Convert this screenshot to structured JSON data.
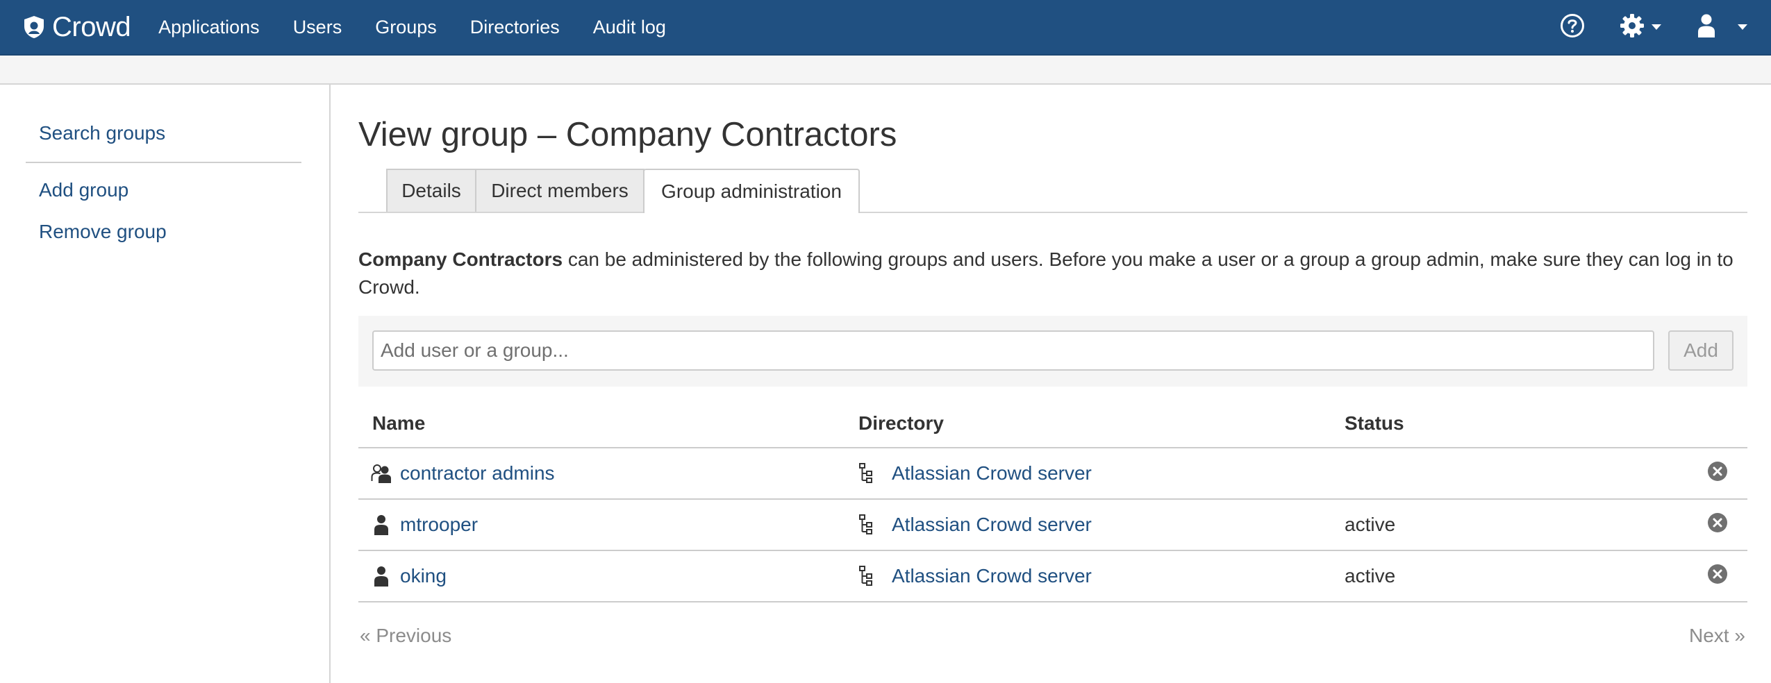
{
  "header": {
    "logo_text": "Crowd",
    "nav": [
      "Applications",
      "Users",
      "Groups",
      "Directories",
      "Audit log"
    ],
    "icons": [
      "help-icon",
      "gear-icon",
      "user-icon"
    ]
  },
  "sidebar": {
    "items": [
      {
        "label": "Search groups"
      },
      {
        "label": "Add group"
      },
      {
        "label": "Remove group"
      }
    ]
  },
  "page": {
    "title": "View group – Company Contractors",
    "tabs": [
      {
        "label": "Details",
        "active": false
      },
      {
        "label": "Direct members",
        "active": false
      },
      {
        "label": "Group administration",
        "active": true
      }
    ],
    "description_bold": "Company Contractors",
    "description_rest": " can be administered by the following groups and users. Before you make a user or a group a group admin, make sure they can log in to Crowd.",
    "add_placeholder": "Add user or a group...",
    "add_button": "Add"
  },
  "table": {
    "headers": [
      "Name",
      "Directory",
      "Status"
    ],
    "rows": [
      {
        "type": "group",
        "icon": "group-icon",
        "name": "contractor admins",
        "directory": "Atlassian Crowd server",
        "status": ""
      },
      {
        "type": "user",
        "icon": "user-icon",
        "name": "mtrooper",
        "directory": "Atlassian Crowd server",
        "status": "active"
      },
      {
        "type": "user",
        "icon": "user-icon",
        "name": "oking",
        "directory": "Atlassian Crowd server",
        "status": "active"
      }
    ]
  },
  "pager": {
    "previous": "« Previous",
    "next": "Next »"
  },
  "colors": {
    "header_bg": "#205081",
    "link": "#205081",
    "text": "#333333"
  }
}
